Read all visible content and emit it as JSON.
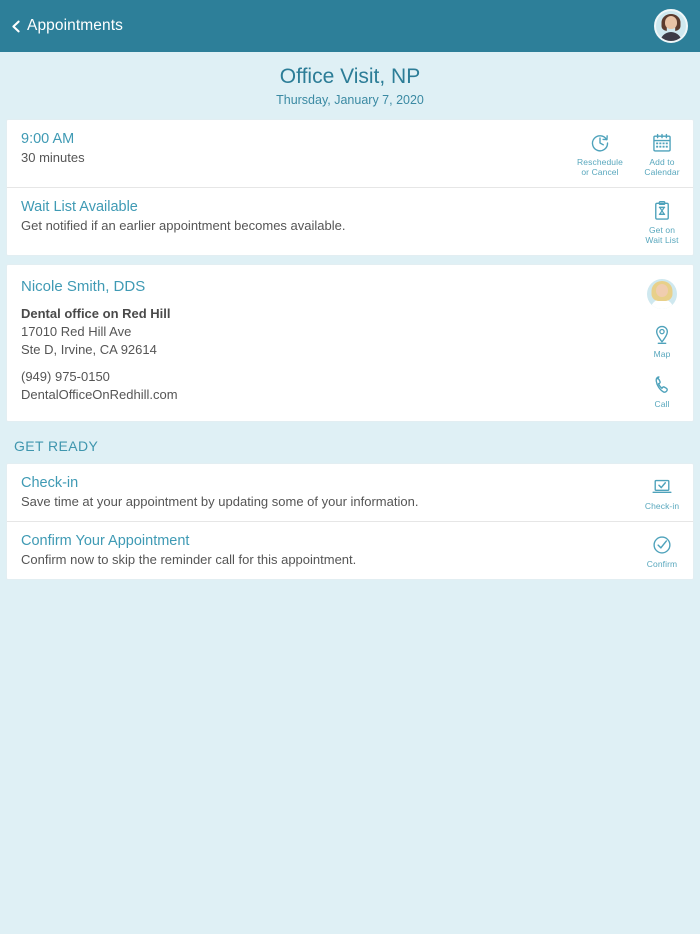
{
  "navbar": {
    "back_label": "Appointments",
    "back_icon": "chevron-left-icon",
    "avatar_icon": "user-avatar"
  },
  "header": {
    "title": "Office Visit, NP",
    "date": "Thursday, January 7, 2020"
  },
  "appointment_card": {
    "time": "9:00 AM",
    "duration": "30 minutes",
    "actions": [
      {
        "icon": "clock-refresh-icon",
        "caption_line1": "Reschedule",
        "caption_line2": "or Cancel"
      },
      {
        "icon": "calendar-add-icon",
        "caption_line1": "Add to",
        "caption_line2": "Calendar"
      }
    ],
    "waitlist": {
      "title": "Wait List Available",
      "description": "Get notified if an earlier appointment becomes available.",
      "action": {
        "icon": "clipboard-hourglass-icon",
        "caption_line1": "Get on",
        "caption_line2": "Wait List"
      }
    }
  },
  "provider_card": {
    "provider_name": "Nicole Smith, DDS",
    "office_name": "Dental office on Red Hill",
    "address_line1": "17010 Red Hill Ave",
    "address_line2": "Ste D, Irvine, CA 92614",
    "phone": "(949) 975-0150",
    "website": "DentalOfficeOnRedhill.com",
    "avatar_icon": "provider-avatar",
    "actions": [
      {
        "icon": "map-pin-icon",
        "caption": "Map"
      },
      {
        "icon": "phone-icon",
        "caption": "Call"
      }
    ]
  },
  "get_ready": {
    "section_title": "GET READY",
    "items": [
      {
        "title": "Check-in",
        "description": "Save time at your appointment by updating some of your information.",
        "action": {
          "icon": "laptop-check-icon",
          "caption": "Check-in"
        }
      },
      {
        "title": "Confirm Your Appointment",
        "description": "Confirm now to skip the reminder call for this appointment.",
        "action": {
          "icon": "circle-check-icon",
          "caption": "Confirm"
        }
      }
    ]
  },
  "colors": {
    "navbar": "#2d7f99",
    "page_background": "#dff0f5",
    "accent_link": "#3f9ab4",
    "title": "#2c7d97",
    "caption": "#58a7bd"
  }
}
